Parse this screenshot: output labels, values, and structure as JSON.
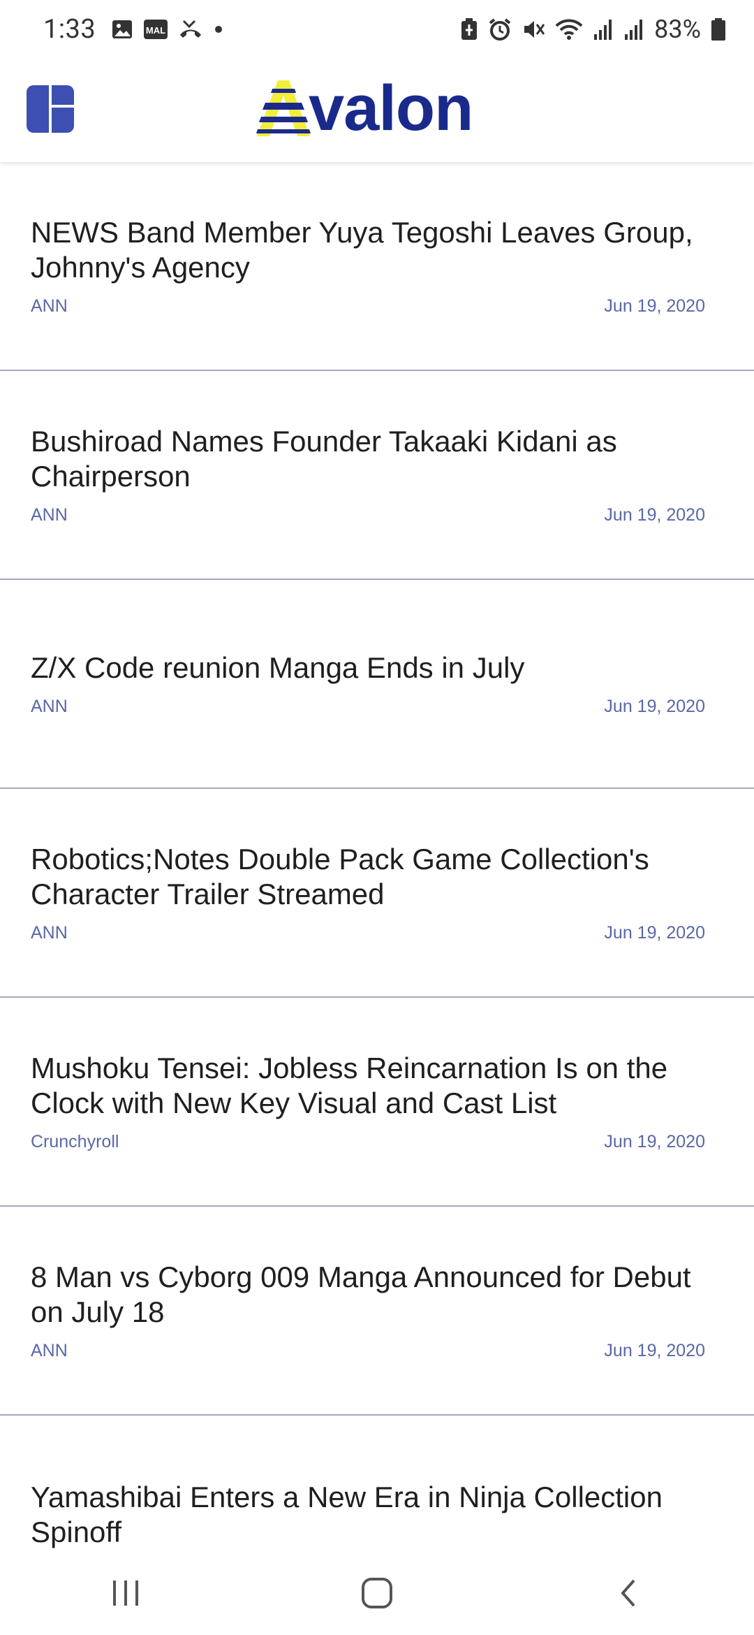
{
  "status_bar": {
    "time": "1:33",
    "battery_percent": "83%",
    "left_icons": [
      "image-icon",
      "mal-icon",
      "missed-call-icon",
      "dot-icon"
    ],
    "right_icons": [
      "battery-saver-icon",
      "alarm-icon",
      "mute-icon",
      "wifi-icon",
      "signal-icon",
      "signal-icon",
      "battery-icon"
    ]
  },
  "header": {
    "logo_text": "valon",
    "logo_initial": "A",
    "brand_color": "#1a2a8c",
    "accent_color": "#f2ee3a"
  },
  "feed": {
    "items": [
      {
        "title": "NEWS Band Member Yuya Tegoshi Leaves Group, Johnny's Agency",
        "source": "ANN",
        "date": "Jun 19, 2020"
      },
      {
        "title": "Bushiroad Names Founder Takaaki Kidani as Chairperson",
        "source": "ANN",
        "date": "Jun 19, 2020"
      },
      {
        "title": "Z/X Code reunion Manga Ends in July",
        "source": "ANN",
        "date": "Jun 19, 2020"
      },
      {
        "title": "Robotics;Notes Double Pack Game Collection's Character Trailer Streamed",
        "source": "ANN",
        "date": "Jun 19, 2020"
      },
      {
        "title": "Mushoku Tensei: Jobless Reincarnation Is on the Clock with New Key Visual and Cast List",
        "source": "Crunchyroll",
        "date": "Jun 19, 2020"
      },
      {
        "title": "8 Man vs Cyborg 009 Manga Announced for Debut on July 18",
        "source": "ANN",
        "date": "Jun 19, 2020"
      },
      {
        "title": "Yamashibai Enters a New Era in Ninja Collection Spinoff",
        "source": "",
        "date": ""
      }
    ]
  },
  "nav_bar": {
    "buttons": [
      "recents-icon",
      "home-icon",
      "back-icon"
    ]
  }
}
